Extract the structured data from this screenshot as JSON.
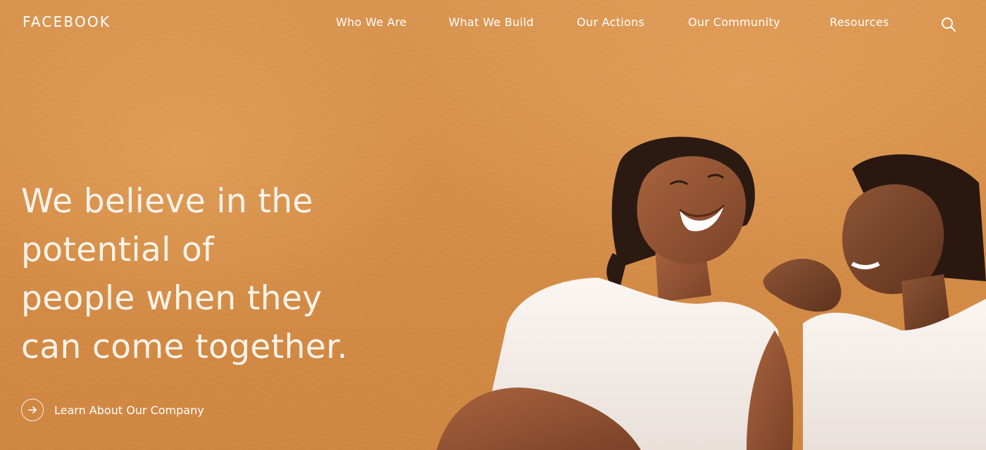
{
  "brand": {
    "logo_text": "FACEBOOK"
  },
  "nav": {
    "items": [
      {
        "label": "Who We Are"
      },
      {
        "label": "What We Build"
      },
      {
        "label": "Our Actions"
      },
      {
        "label": "Our Community"
      },
      {
        "label": "Resources"
      }
    ],
    "search_icon": "search-icon"
  },
  "hero": {
    "headline_lines": [
      "We believe in the",
      "potential of",
      "people when they",
      "can come together."
    ],
    "cta": {
      "label": "Learn About Our Company",
      "icon": "arrow-right-icon"
    }
  },
  "colors": {
    "background": "#d8924a",
    "text": "#ffffff"
  }
}
